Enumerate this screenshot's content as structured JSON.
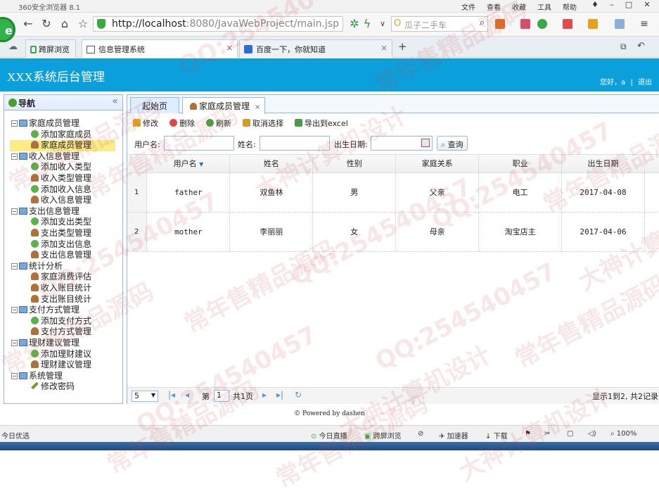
{
  "browser": {
    "name": "360安全浏览器 8.1",
    "menu": [
      "文件",
      "查看",
      "收藏",
      "工具",
      "帮助"
    ],
    "url_host": "http://localhost",
    "url_rest": ":8080/JavaWebProject/main.jsp",
    "search_placeholder": "瓜子二手车",
    "tabs": [
      {
        "label": "跨屏浏览"
      },
      {
        "label": "信息管理系统",
        "close": "×"
      },
      {
        "label": "百度一下，你就知道",
        "close": "×"
      }
    ],
    "new_tab": "+"
  },
  "app": {
    "title": "XXX系统后台管理",
    "greeting": "您好，a",
    "logout": "退出"
  },
  "nav": {
    "title": "导航",
    "collapse": "«",
    "groups": [
      {
        "label": "家庭成员管理",
        "items": [
          {
            "label": "添加家庭成员",
            "icon": "plus"
          },
          {
            "label": "家庭成员管理",
            "icon": "user",
            "selected": true
          }
        ]
      },
      {
        "label": "收入信息管理",
        "items": [
          {
            "label": "添加收入类型",
            "icon": "plus"
          },
          {
            "label": "收入类型管理",
            "icon": "user"
          },
          {
            "label": "添加收入信息",
            "icon": "plus"
          },
          {
            "label": "收入信息管理",
            "icon": "user"
          }
        ]
      },
      {
        "label": "支出信息管理",
        "items": [
          {
            "label": "添加支出类型",
            "icon": "plus"
          },
          {
            "label": "支出类型管理",
            "icon": "user"
          },
          {
            "label": "添加支出信息",
            "icon": "plus"
          },
          {
            "label": "支出信息管理",
            "icon": "user"
          }
        ]
      },
      {
        "label": "统计分析",
        "items": [
          {
            "label": "家庭消费评估",
            "icon": "user"
          },
          {
            "label": "收入账目统计",
            "icon": "user"
          },
          {
            "label": "支出账目统计",
            "icon": "user"
          }
        ]
      },
      {
        "label": "支付方式管理",
        "items": [
          {
            "label": "添加支付方式",
            "icon": "plus"
          },
          {
            "label": "支付方式管理",
            "icon": "user"
          }
        ]
      },
      {
        "label": "理财建议管理",
        "items": [
          {
            "label": "添加理财建议",
            "icon": "plus"
          },
          {
            "label": "理财建议管理",
            "icon": "user"
          }
        ]
      },
      {
        "label": "系统管理",
        "items": [
          {
            "label": "修改密码",
            "icon": "pen"
          }
        ]
      }
    ]
  },
  "page_tabs": [
    {
      "label": "起始页"
    },
    {
      "label": "家庭成员管理",
      "close": "×"
    }
  ],
  "toolbar": {
    "edit": "修改",
    "delete": "删除",
    "refresh": "刷新",
    "unselect": "取消选择",
    "export": "导出到excel"
  },
  "filter": {
    "username_label": "用户名:",
    "name_label": "姓名:",
    "birthday_label": "出生日期:",
    "query_button": "查询"
  },
  "grid": {
    "columns": [
      "用户名",
      "姓名",
      "性别",
      "家庭关系",
      "职业",
      "出生日期"
    ],
    "rows": [
      {
        "n": "1",
        "cells": [
          "father",
          "双鱼林",
          "男",
          "父亲",
          "电工",
          "2017-04-08"
        ]
      },
      {
        "n": "2",
        "cells": [
          "mother",
          "李丽丽",
          "女",
          "母亲",
          "淘宝店主",
          "2017-04-06"
        ]
      }
    ]
  },
  "pager": {
    "page_size": "5",
    "page_prefix": "第",
    "page_value": "1",
    "page_suffix": "共1页",
    "info": "显示1到2, 共2记录"
  },
  "footer": "Powered by dashen",
  "statusbar": {
    "left": "今日优选",
    "live": "今日直播",
    "cross": "跨屏浏览",
    "accel": "加速器",
    "download": "下载",
    "zoom": "100%"
  },
  "watermarks": [
    "QQ:254540457",
    "大神计算机设计",
    "常年售精品源码"
  ]
}
